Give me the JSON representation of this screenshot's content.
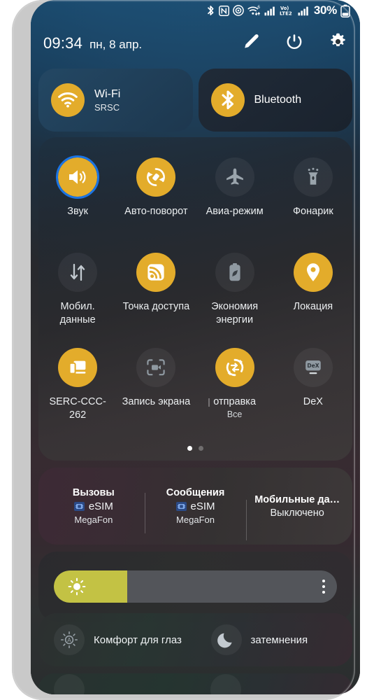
{
  "status_bar": {
    "icons": [
      "bluetooth-icon",
      "nfc-icon",
      "hotspot-icon",
      "wifi-calling-icon",
      "signal-bars-icon",
      "volte2-icon",
      "signal-bars-2-icon"
    ],
    "battery_percent": "30%",
    "battery_icon": "battery-icon"
  },
  "header": {
    "time": "09:34",
    "date": "пн, 8 апр.",
    "actions": [
      {
        "name": "edit-button",
        "icon": "pencil-icon"
      },
      {
        "name": "power-button",
        "icon": "power-icon"
      },
      {
        "name": "settings-button",
        "icon": "gear-icon"
      }
    ]
  },
  "connectivity": [
    {
      "name": "wifi-card",
      "icon": "wifi-icon",
      "title": "Wi-Fi",
      "subtitle": "SRSC",
      "state": "on"
    },
    {
      "name": "bluetooth-card",
      "icon": "bluetooth-icon",
      "title": "Bluetooth",
      "subtitle": "",
      "state": "on"
    }
  ],
  "toggles": [
    {
      "name": "tile-sound",
      "icon": "volume-icon",
      "label": "Звук",
      "sub": "",
      "state": "on",
      "focused": true
    },
    {
      "name": "tile-auto-rotate",
      "icon": "auto-rotate-icon",
      "label": "Авто-поворот",
      "sub": "",
      "state": "on",
      "focused": false
    },
    {
      "name": "tile-airplane-mode",
      "icon": "airplane-icon",
      "label": "Авиа-режим",
      "sub": "",
      "state": "off",
      "focused": false
    },
    {
      "name": "tile-flashlight",
      "icon": "flashlight-icon",
      "label": "Фонарик",
      "sub": "",
      "state": "off",
      "focused": false
    },
    {
      "name": "tile-mobile-data",
      "icon": "data-arrows-icon",
      "label": "Мобил. данные",
      "sub": "",
      "state": "off",
      "focused": false
    },
    {
      "name": "tile-hotspot",
      "icon": "hotspot-icon",
      "label": "Точка доступа",
      "sub": "",
      "state": "on",
      "focused": false
    },
    {
      "name": "tile-power-saving",
      "icon": "battery-leaf-icon",
      "label": "Экономия энергии",
      "sub": "",
      "state": "off",
      "focused": false
    },
    {
      "name": "tile-location",
      "icon": "location-pin-icon",
      "label": "Локация",
      "sub": "",
      "state": "on",
      "focused": false
    },
    {
      "name": "tile-smart-view",
      "icon": "smart-view-icon",
      "label": "SERC-CCC-262",
      "sub": "",
      "state": "on",
      "focused": false
    },
    {
      "name": "tile-screen-record",
      "icon": "screen-record-icon",
      "label": "Запись экрана",
      "sub": "",
      "state": "off",
      "focused": false
    },
    {
      "name": "tile-nearby-share",
      "icon": "nearby-share-icon",
      "label": "отправка",
      "sub": "Все",
      "state": "on",
      "focused": false,
      "clipped": true
    },
    {
      "name": "tile-dex",
      "icon": "dex-icon",
      "label": "DeX",
      "sub": "",
      "state": "off",
      "focused": false
    }
  ],
  "page_dots": {
    "count": 2,
    "active_index": 0
  },
  "sim_panel": [
    {
      "name": "sim-calls",
      "title": "Вызовы",
      "value": "eSIM",
      "carrier": "MegaFon",
      "has_chip": true
    },
    {
      "name": "sim-messages",
      "title": "Сообщения",
      "value": "eSIM",
      "carrier": "MegaFon",
      "has_chip": true
    },
    {
      "name": "sim-mobile-data",
      "title": "Мобильные да…",
      "value": "Выключено",
      "carrier": "",
      "has_chip": false
    }
  ],
  "brightness": {
    "name": "brightness-slider",
    "percent": 26,
    "fill_color": "#c3c244",
    "track_color": "#53555a",
    "sun_icon": "sun-icon",
    "menu_icon": "more-vertical-icon"
  },
  "eye_comfort": [
    {
      "name": "eye-comfort-shield",
      "icon": "auto-brightness-icon",
      "label": "Комфорт для глаз"
    },
    {
      "name": "dark-mode-toggle",
      "icon": "moon-icon",
      "label": "затемнения"
    }
  ],
  "colors": {
    "accent_yellow": "#e3ac2b",
    "focus_blue": "#1b74e4",
    "brightness_fill": "#c3c244",
    "text_primary": "#ffffff"
  }
}
